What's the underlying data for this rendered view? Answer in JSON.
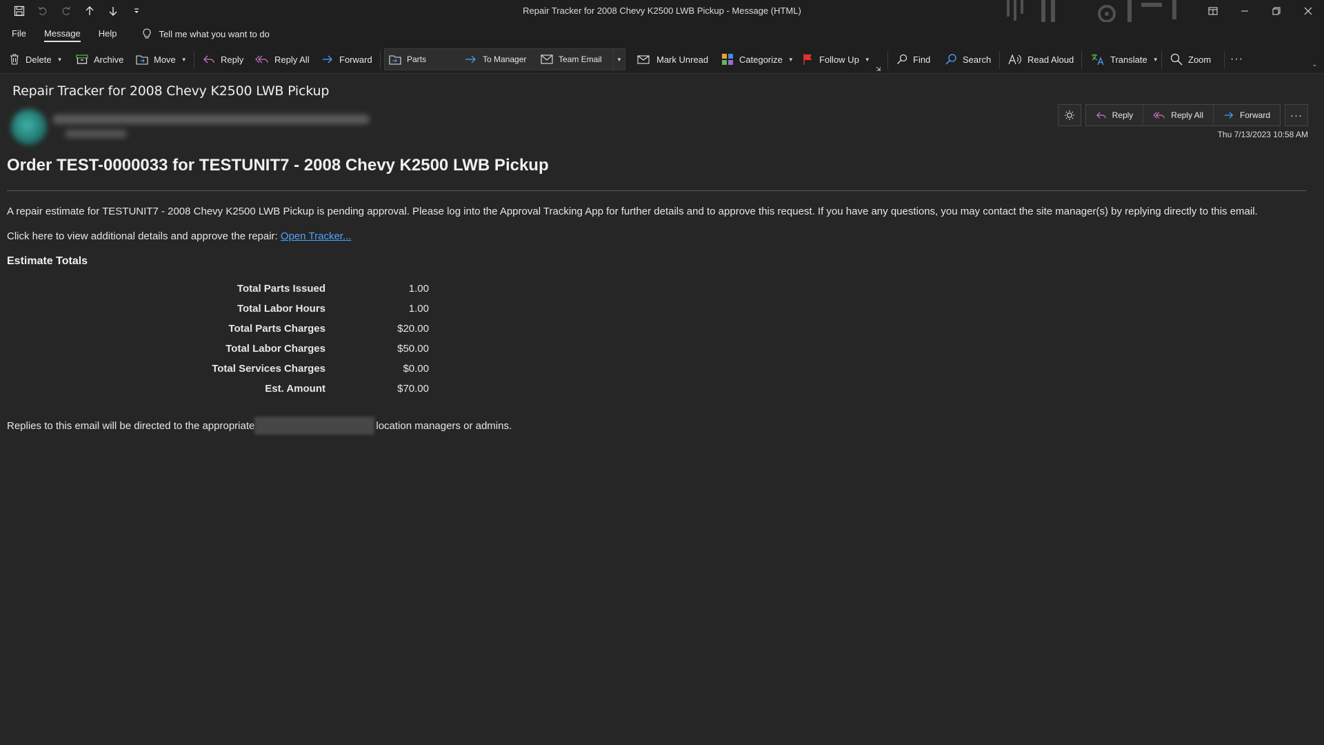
{
  "window": {
    "title": "Repair Tracker for 2008 Chevy K2500 LWB Pickup  -  Message (HTML)"
  },
  "menu": {
    "tabs": [
      "File",
      "Message",
      "Help"
    ],
    "active_tab": "Message",
    "tell_me": "Tell me what you want to do"
  },
  "ribbon": {
    "delete": "Delete",
    "archive": "Archive",
    "move": "Move",
    "reply": "Reply",
    "reply_all": "Reply All",
    "forward": "Forward",
    "quick_steps": [
      "Parts",
      "To Manager",
      "Team Email"
    ],
    "mark_unread": "Mark Unread",
    "categorize": "Categorize",
    "follow_up": "Follow Up",
    "find": "Find",
    "search": "Search",
    "read_aloud": "Read Aloud",
    "translate": "Translate",
    "zoom": "Zoom",
    "colors": {
      "follow_up_flag": "#e0322c",
      "categorize": [
        "#e8a32b",
        "#3c8fdd",
        "#5cb85c",
        "#9b6bd6"
      ]
    }
  },
  "message": {
    "subject": "Repair Tracker for 2008 Chevy K2500 LWB Pickup",
    "actions": {
      "reply": "Reply",
      "reply_all": "Reply All",
      "forward": "Forward"
    },
    "datetime": "Thu 7/13/2023 10:58 AM",
    "body": {
      "heading": "Order TEST-0000033 for TESTUNIT7 - 2008 Chevy K2500 LWB Pickup",
      "paragraph1": "A repair estimate for TESTUNIT7 - 2008 Chevy K2500 LWB Pickup is pending approval. Please log into the Approval Tracking App for further details and to approve this request. If you have any questions, you may contact the site manager(s) by replying directly to this email.",
      "paragraph2_prefix": "Click here to view additional details and approve the repair: ",
      "link_text": "Open Tracker...",
      "estimate_heading": "Estimate Totals",
      "totals": [
        {
          "label": "Total Parts Issued",
          "value": "1.00"
        },
        {
          "label": "Total Labor Hours",
          "value": "1.00"
        },
        {
          "label": "Total Parts Charges",
          "value": "$20.00"
        },
        {
          "label": "Total Labor Charges",
          "value": "$50.00"
        },
        {
          "label": "Total Services Charges",
          "value": "$0.00"
        },
        {
          "label": "Est. Amount",
          "value": "$70.00"
        }
      ],
      "footer_prefix": "Replies to this email will be directed to the appropriate",
      "footer_suffix": " location managers or admins."
    }
  }
}
